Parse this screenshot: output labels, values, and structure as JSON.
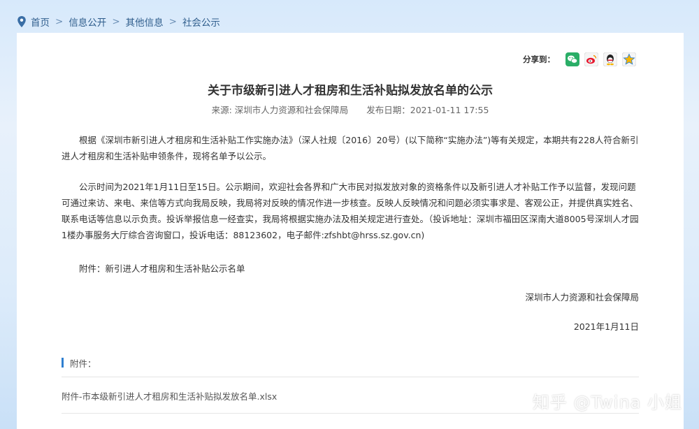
{
  "breadcrumb": {
    "items": [
      "首页",
      "信息公开",
      "其他信息",
      "社会公示"
    ],
    "separator": ">"
  },
  "share": {
    "label": "分享到：",
    "icons": [
      "wechat-icon",
      "weibo-icon",
      "qq-icon",
      "qzone-icon"
    ]
  },
  "article": {
    "title": "关于市级新引进人才租房和生活补贴拟发放名单的公示",
    "source": "来源: 深圳市人力资源和社会保障局",
    "date": "发布日期：2021-01-11 17:55",
    "paragraphs": [
      "根据《深圳市新引进人才租房和生活补贴工作实施办法》（深人社规〔2016〕20号）(以下简称“实施办法”)等有关规定，本期共有228人符合新引进人才租房和生活补贴申领条件，现将名单予以公示。",
      "公示时间为2021年1月11日至15日。公示期间，欢迎社会各界和广大市民对拟发放对象的资格条件以及新引进人才补贴工作予以监督，发现问题可通过来访、来电、来信等方式向我局反映，我局将对反映的情况作进一步核查。反映人反映情况和问题必须实事求是、客观公正，并提供真实姓名、联系电话等信息以示负责。投诉举报信息一经查实，我局将根据实施办法及相关规定进行查处。（投诉地址：深圳市福田区深南大道8005号深圳人才园1楼办事服务大厅综合咨询窗口，投诉电话：88123602，电子邮件:zfshbt@hrss.sz.gov.cn)",
      "附件：新引进人才租房和生活补贴公示名单"
    ],
    "signature": "深圳市人力资源和社会保障局",
    "sign_date": "2021年1月11日"
  },
  "attachments": {
    "heading": "附件：",
    "file": "附件-市本级新引进人才租房和生活补贴拟发放名单.xlsx"
  },
  "watermark": "知乎 @Twina 小姐",
  "colors": {
    "accent": "#2f7fd0",
    "link": "#2f5d8c"
  }
}
